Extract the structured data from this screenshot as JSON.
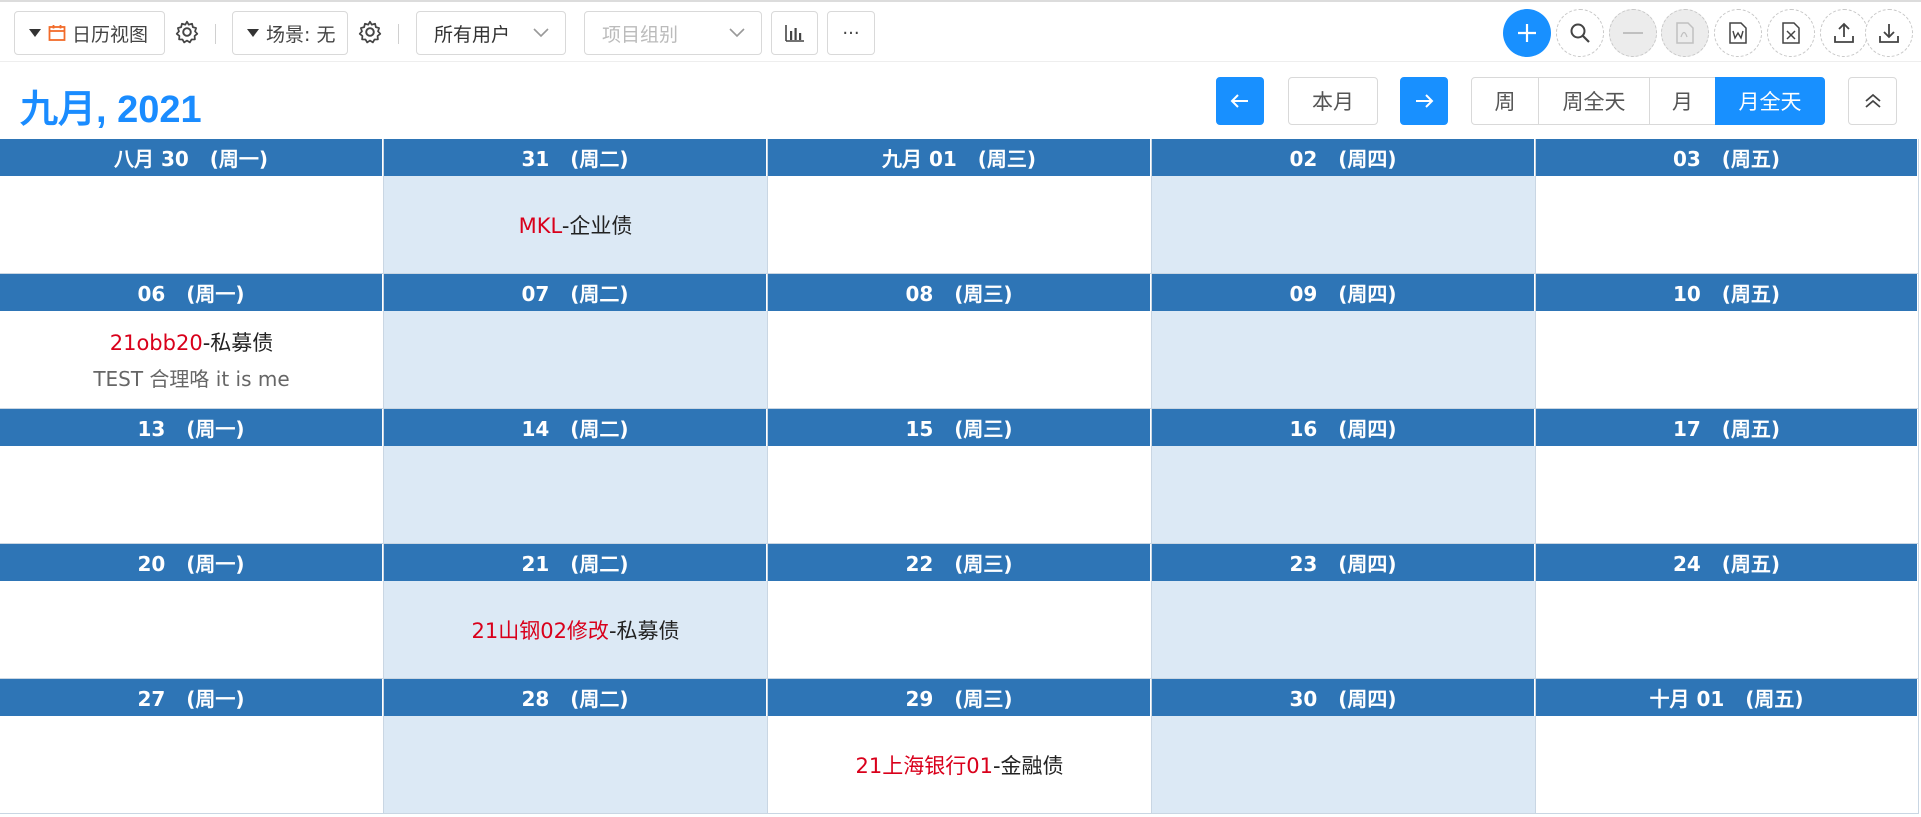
{
  "toolbar": {
    "view_label": "日历视图",
    "scene_label": "场景: 无",
    "users_select": "所有用户",
    "group_placeholder": "项目组别",
    "more_label": "···"
  },
  "header": {
    "title": "九月, 2021",
    "today_label": "本月",
    "modes": [
      "周",
      "周全天",
      "月",
      "月全天"
    ],
    "active_mode": "月全天"
  },
  "colors": {
    "accent": "#1890ff",
    "header_bar": "#2e75b6",
    "event_code": "#d9001b",
    "shaded": "#dce9f5"
  },
  "weeks": [
    {
      "days": [
        {
          "label": "八月 30   (周一)",
          "shaded": false,
          "events": []
        },
        {
          "label": "31   (周二)",
          "shaded": true,
          "events": [
            {
              "code": "MKL",
              "type": "-企业债"
            }
          ]
        },
        {
          "label": "九月 01   (周三)",
          "shaded": false,
          "events": []
        },
        {
          "label": "02   (周四)",
          "shaded": true,
          "events": []
        },
        {
          "label": "03   (周五)",
          "shaded": false,
          "events": []
        }
      ]
    },
    {
      "days": [
        {
          "label": "06   (周一)",
          "shaded": false,
          "events": [
            {
              "code": "21obb20",
              "type": "-私募债",
              "desc": "TEST 合理咯 it is me"
            }
          ]
        },
        {
          "label": "07   (周二)",
          "shaded": true,
          "events": []
        },
        {
          "label": "08   (周三)",
          "shaded": false,
          "events": []
        },
        {
          "label": "09   (周四)",
          "shaded": true,
          "events": []
        },
        {
          "label": "10   (周五)",
          "shaded": false,
          "events": []
        }
      ]
    },
    {
      "days": [
        {
          "label": "13   (周一)",
          "shaded": false,
          "events": []
        },
        {
          "label": "14   (周二)",
          "shaded": true,
          "events": []
        },
        {
          "label": "15   (周三)",
          "shaded": false,
          "events": []
        },
        {
          "label": "16   (周四)",
          "shaded": true,
          "events": []
        },
        {
          "label": "17   (周五)",
          "shaded": false,
          "events": []
        }
      ]
    },
    {
      "days": [
        {
          "label": "20   (周一)",
          "shaded": false,
          "events": []
        },
        {
          "label": "21   (周二)",
          "shaded": true,
          "events": [
            {
              "code": "21山钢02修改",
              "type": "-私募债"
            }
          ]
        },
        {
          "label": "22   (周三)",
          "shaded": false,
          "events": []
        },
        {
          "label": "23   (周四)",
          "shaded": true,
          "events": []
        },
        {
          "label": "24   (周五)",
          "shaded": false,
          "events": []
        }
      ]
    },
    {
      "days": [
        {
          "label": "27   (周一)",
          "shaded": false,
          "events": []
        },
        {
          "label": "28   (周二)",
          "shaded": true,
          "events": []
        },
        {
          "label": "29   (周三)",
          "shaded": false,
          "events": [
            {
              "code": "21上海银行01",
              "type": "-金融债"
            }
          ]
        },
        {
          "label": "30   (周四)",
          "shaded": true,
          "events": []
        },
        {
          "label": "十月 01   (周五)",
          "shaded": false,
          "events": []
        }
      ]
    }
  ]
}
